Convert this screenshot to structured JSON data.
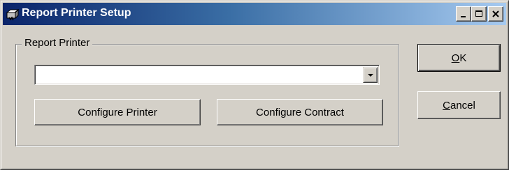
{
  "window": {
    "title": "Report Printer Setup",
    "icon": "printer-app-icon",
    "controls": [
      "minimize-icon",
      "maximize-icon",
      "close-icon"
    ]
  },
  "report_printer_group": {
    "label": "Report Printer",
    "printer_select": {
      "selected_value": ""
    },
    "configure_printer_label": "Configure Printer",
    "configure_contract_label": "Configure Contract"
  },
  "buttons": {
    "ok": {
      "accel": "O",
      "rest": "K"
    },
    "cancel": {
      "accel": "C",
      "rest": "ancel"
    }
  },
  "colors": {
    "title_gradient_start": "#0a246a",
    "title_gradient_end": "#a6caf0",
    "face": "#d4d0c8"
  }
}
